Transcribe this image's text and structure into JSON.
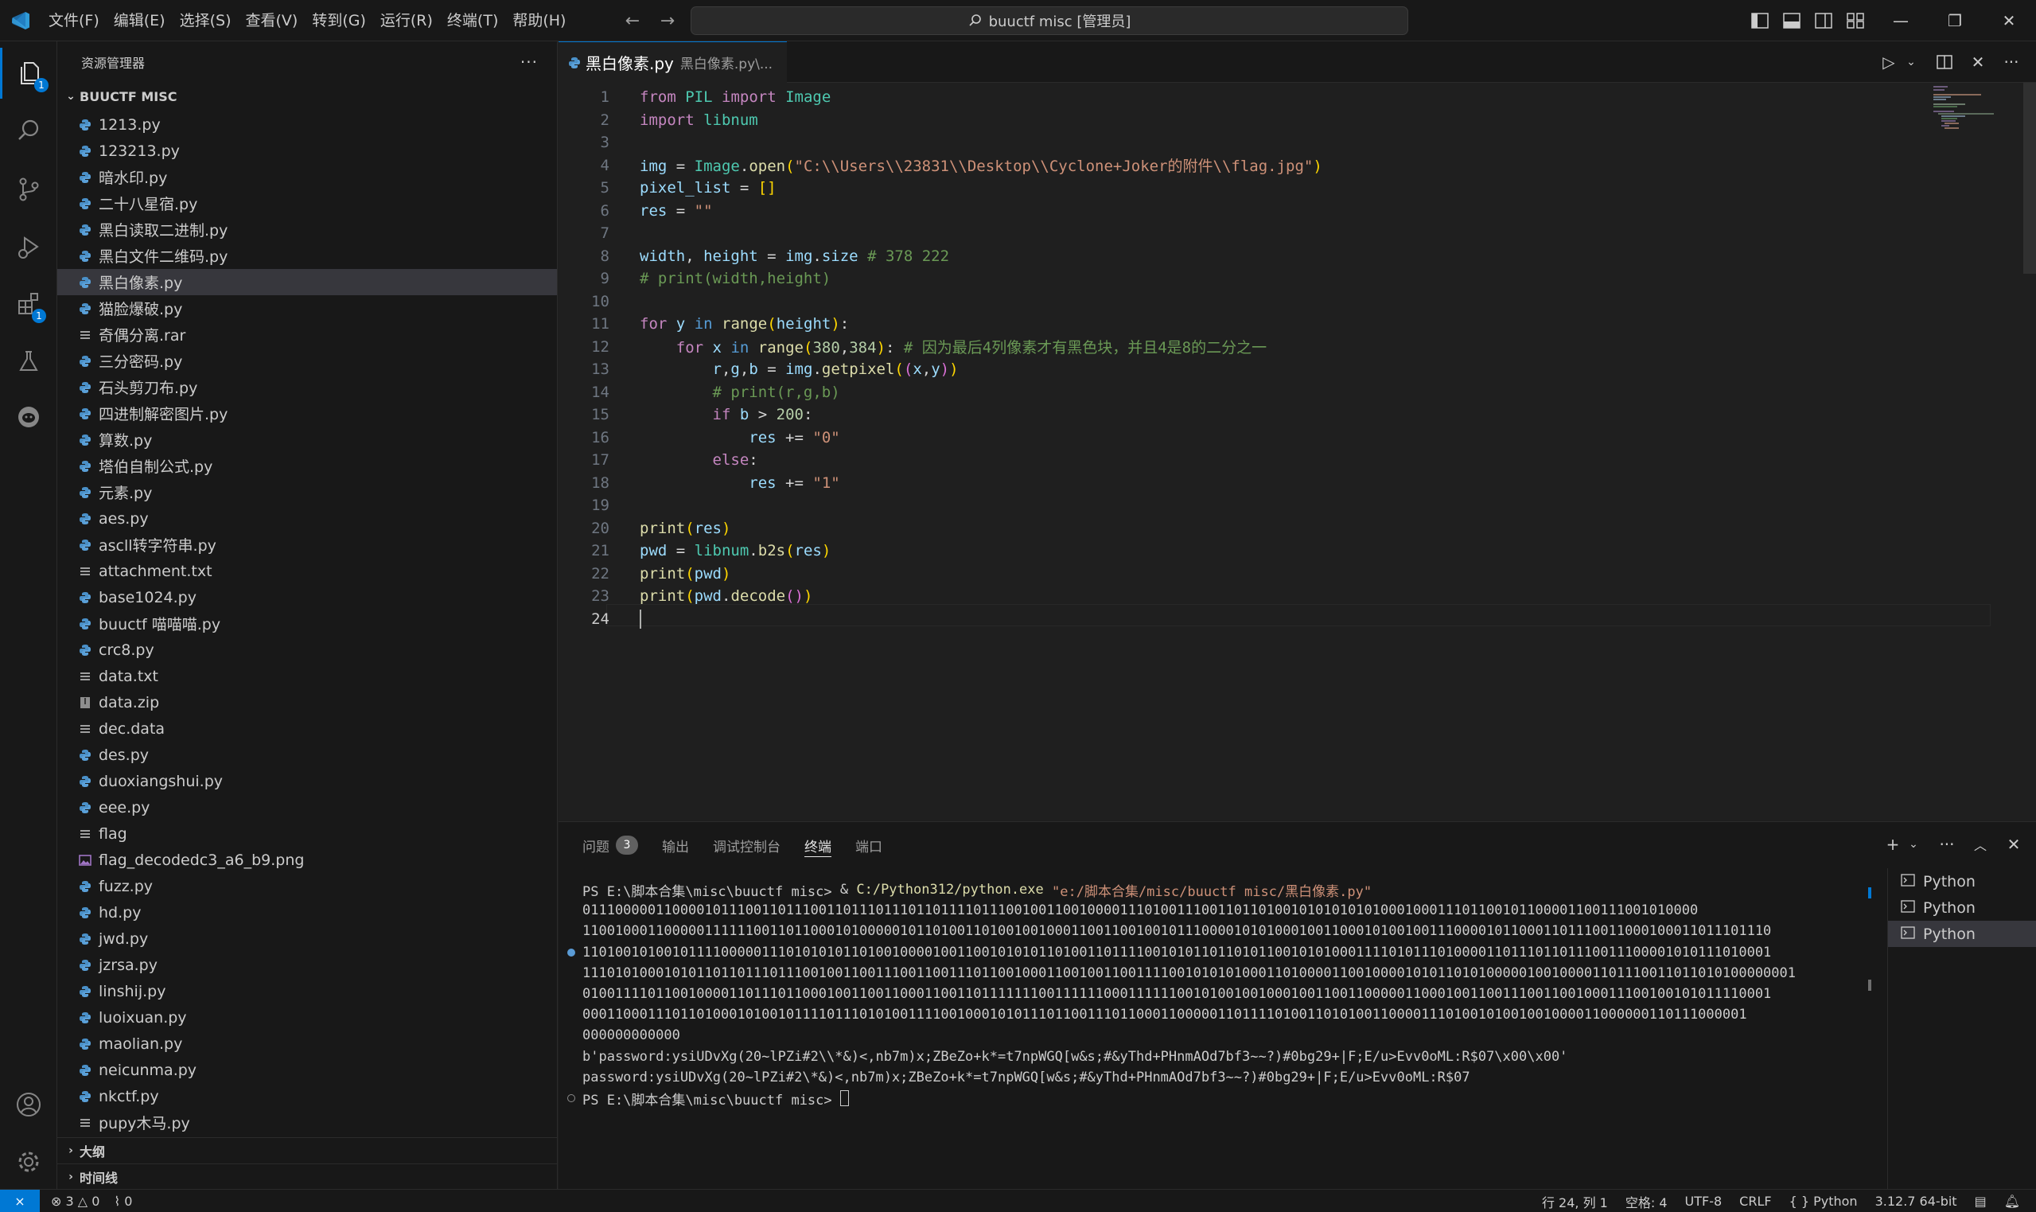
{
  "titlebar": {
    "menu": [
      "文件(F)",
      "编辑(E)",
      "选择(S)",
      "查看(V)",
      "转到(G)",
      "运行(R)",
      "终端(T)",
      "帮助(H)"
    ],
    "search_text": "buuctf misc [管理员]"
  },
  "activitybar": {
    "explorer_badge": "1",
    "extensions_badge": "1"
  },
  "sidebar": {
    "title": "资源管理器",
    "more": "···",
    "folder": "BUUCTF MISC",
    "files": [
      {
        "name": "1213.py",
        "type": "python"
      },
      {
        "name": "123213.py",
        "type": "python"
      },
      {
        "name": "暗水印.py",
        "type": "python"
      },
      {
        "name": "二十八星宿.py",
        "type": "python"
      },
      {
        "name": "黑白读取二进制.py",
        "type": "python"
      },
      {
        "name": "黑白文件二维码.py",
        "type": "python"
      },
      {
        "name": "黑白像素.py",
        "type": "python",
        "selected": true
      },
      {
        "name": "猫脸爆破.py",
        "type": "python"
      },
      {
        "name": "奇偶分离.rar",
        "type": "text"
      },
      {
        "name": "三分密码.py",
        "type": "python"
      },
      {
        "name": "石头剪刀布.py",
        "type": "python"
      },
      {
        "name": "四进制解密图片.py",
        "type": "python"
      },
      {
        "name": "算数.py",
        "type": "python"
      },
      {
        "name": "塔伯自制公式.py",
        "type": "python"
      },
      {
        "name": "元素.py",
        "type": "python"
      },
      {
        "name": "aes.py",
        "type": "python"
      },
      {
        "name": "ascll转字符串.py",
        "type": "python"
      },
      {
        "name": "attachment.txt",
        "type": "text"
      },
      {
        "name": "base1024.py",
        "type": "python"
      },
      {
        "name": "buuctf 喵喵喵.py",
        "type": "python"
      },
      {
        "name": "crc8.py",
        "type": "python"
      },
      {
        "name": "data.txt",
        "type": "text"
      },
      {
        "name": "data.zip",
        "type": "zip"
      },
      {
        "name": "dec.data",
        "type": "text"
      },
      {
        "name": "des.py",
        "type": "python"
      },
      {
        "name": "duoxiangshui.py",
        "type": "python"
      },
      {
        "name": "eee.py",
        "type": "python"
      },
      {
        "name": "flag",
        "type": "text"
      },
      {
        "name": "flag_decodedc3_a6_b9.png",
        "type": "image"
      },
      {
        "name": "fuzz.py",
        "type": "python"
      },
      {
        "name": "hd.py",
        "type": "python"
      },
      {
        "name": "jwd.py",
        "type": "python"
      },
      {
        "name": "jzrsa.py",
        "type": "python"
      },
      {
        "name": "linshij.py",
        "type": "python"
      },
      {
        "name": "luoixuan.py",
        "type": "python"
      },
      {
        "name": "maolian.py",
        "type": "python"
      },
      {
        "name": "neicunma.py",
        "type": "python"
      },
      {
        "name": "nkctf.py",
        "type": "python"
      },
      {
        "name": "pupy木马.py",
        "type": "text"
      }
    ],
    "outline": "大纲",
    "timeline": "时间线"
  },
  "editor": {
    "tab_name": "黑白像素.py",
    "tab_desc": "黑白像素.py\\...",
    "line_numbers": [
      "1",
      "2",
      "3",
      "4",
      "5",
      "6",
      "7",
      "8",
      "9",
      "10",
      "11",
      "12",
      "13",
      "14",
      "15",
      "16",
      "17",
      "18",
      "19",
      "20",
      "21",
      "22",
      "23",
      "24"
    ],
    "lines": [
      [
        [
          "kw",
          "from"
        ],
        [
          "p",
          " "
        ],
        [
          "cls",
          "PIL"
        ],
        [
          "p",
          " "
        ],
        [
          "kw",
          "import"
        ],
        [
          "p",
          " "
        ],
        [
          "cls",
          "Image"
        ]
      ],
      [
        [
          "kw",
          "import"
        ],
        [
          "p",
          " "
        ],
        [
          "cls",
          "libnum"
        ]
      ],
      [],
      [
        [
          "var",
          "img"
        ],
        [
          "p",
          " = "
        ],
        [
          "cls",
          "Image"
        ],
        [
          "p",
          "."
        ],
        [
          "fn",
          "open"
        ],
        [
          "br1",
          "("
        ],
        [
          "str",
          "\"C:\\\\Users\\\\23831\\\\Desktop\\\\Cyclone+Joker的附件\\\\flag.jpg\""
        ],
        [
          "br1",
          ")"
        ]
      ],
      [
        [
          "var",
          "pixel_list"
        ],
        [
          "p",
          " = "
        ],
        [
          "br1",
          "[]"
        ]
      ],
      [
        [
          "var",
          "res"
        ],
        [
          "p",
          " = "
        ],
        [
          "str",
          "\"\""
        ]
      ],
      [],
      [
        [
          "var",
          "width"
        ],
        [
          "p",
          ", "
        ],
        [
          "var",
          "height"
        ],
        [
          "p",
          " = "
        ],
        [
          "var",
          "img"
        ],
        [
          "p",
          "."
        ],
        [
          "var",
          "size"
        ],
        [
          "p",
          " "
        ],
        [
          "cm",
          "# 378 222"
        ]
      ],
      [
        [
          "cm",
          "# print(width,height)"
        ]
      ],
      [],
      [
        [
          "kw",
          "for"
        ],
        [
          "p",
          " "
        ],
        [
          "var",
          "y"
        ],
        [
          "p",
          " "
        ],
        [
          "kw2",
          "in"
        ],
        [
          "p",
          " "
        ],
        [
          "fn",
          "range"
        ],
        [
          "br1",
          "("
        ],
        [
          "var",
          "height"
        ],
        [
          "br1",
          ")"
        ],
        [
          "p",
          ":"
        ]
      ],
      [
        [
          "p",
          "    "
        ],
        [
          "kw",
          "for"
        ],
        [
          "p",
          " "
        ],
        [
          "var",
          "x"
        ],
        [
          "p",
          " "
        ],
        [
          "kw2",
          "in"
        ],
        [
          "p",
          " "
        ],
        [
          "fn",
          "range"
        ],
        [
          "br1",
          "("
        ],
        [
          "num",
          "380"
        ],
        [
          "p",
          ","
        ],
        [
          "num",
          "384"
        ],
        [
          "br1",
          ")"
        ],
        [
          "p",
          ": "
        ],
        [
          "cm",
          "# 因为最后4列像素才有黑色块，并且4是8的二分之一"
        ]
      ],
      [
        [
          "p",
          "        "
        ],
        [
          "var",
          "r"
        ],
        [
          "p",
          ","
        ],
        [
          "var",
          "g"
        ],
        [
          "p",
          ","
        ],
        [
          "var",
          "b"
        ],
        [
          "p",
          " = "
        ],
        [
          "var",
          "img"
        ],
        [
          "p",
          "."
        ],
        [
          "fn",
          "getpixel"
        ],
        [
          "br1",
          "("
        ],
        [
          "br2",
          "("
        ],
        [
          "var",
          "x"
        ],
        [
          "p",
          ","
        ],
        [
          "var",
          "y"
        ],
        [
          "br2",
          ")"
        ],
        [
          "br1",
          ")"
        ]
      ],
      [
        [
          "p",
          "        "
        ],
        [
          "cm",
          "# print(r,g,b)"
        ]
      ],
      [
        [
          "p",
          "        "
        ],
        [
          "kw",
          "if"
        ],
        [
          "p",
          " "
        ],
        [
          "var",
          "b"
        ],
        [
          "p",
          " > "
        ],
        [
          "num",
          "200"
        ],
        [
          "p",
          ":"
        ]
      ],
      [
        [
          "p",
          "            "
        ],
        [
          "var",
          "res"
        ],
        [
          "p",
          " += "
        ],
        [
          "str",
          "\"0\""
        ]
      ],
      [
        [
          "p",
          "        "
        ],
        [
          "kw",
          "else"
        ],
        [
          "p",
          ":"
        ]
      ],
      [
        [
          "p",
          "            "
        ],
        [
          "var",
          "res"
        ],
        [
          "p",
          " += "
        ],
        [
          "str",
          "\"1\""
        ]
      ],
      [],
      [
        [
          "fn",
          "print"
        ],
        [
          "br1",
          "("
        ],
        [
          "var",
          "res"
        ],
        [
          "br1",
          ")"
        ]
      ],
      [
        [
          "var",
          "pwd"
        ],
        [
          "p",
          " = "
        ],
        [
          "cls",
          "libnum"
        ],
        [
          "p",
          "."
        ],
        [
          "fn",
          "b2s"
        ],
        [
          "br1",
          "("
        ],
        [
          "var",
          "res"
        ],
        [
          "br1",
          ")"
        ]
      ],
      [
        [
          "fn",
          "print"
        ],
        [
          "br1",
          "("
        ],
        [
          "var",
          "pwd"
        ],
        [
          "br1",
          ")"
        ]
      ],
      [
        [
          "fn",
          "print"
        ],
        [
          "br1",
          "("
        ],
        [
          "var",
          "pwd"
        ],
        [
          "p",
          "."
        ],
        [
          "fn",
          "decode"
        ],
        [
          "br2",
          "()"
        ],
        [
          "br1",
          ")"
        ]
      ],
      []
    ]
  },
  "panel": {
    "tabs": [
      "问题",
      "输出",
      "调试控制台",
      "终端",
      "端口"
    ],
    "problems_count": "3",
    "active_tab": "终端",
    "terminal": {
      "prompt1": "PS E:\\脚本合集\\misc\\buuctf misc> ",
      "cmd_amp": "& ",
      "cmd_exe": "C:/Python312/python.exe",
      "cmd_arg": " \"e:/脚本合集/misc/buuctf misc/黑白像素.py\"",
      "output": [
        "01110000011000010111001101110011011101110110111101110010011001000011101001110011011010010101010101000100011101100101100001100111001010000",
        "11001000110000011111100110110001010000010110100110100100100011001100100101110000101010001001100010100100111000010110001101110011000100011011101110",
        "11010010100101111000001110101010110100100001001100101010110100110111100101011011010110010101000111101011101000011011101101110011100001010111010001",
        "11101010001010110110111011100100110011100110011101100100011001001100111100101010100011010000110010000101011010100000100100001101110011011010100000001",
        "01001111011001000011011101100010011001100011001101111111001111110001111110010100100100010011001100000110001001100111001100100011100100101011110001",
        "00011000111011010001010010111101110101001111001000101011101100111011000110000011011110100110101001100001110100101001001000011000000110111000001",
        "000000000000",
        "b'password:ysiUDvXg(20~lPZi#2\\\\*&)<,nb7m)x;ZBeZo+k*=t7npWGQ[w&s;#&yThd+PHnmAOd7bf3~~?)#0bg29+|F;E/u>Evv0oML:R$07\\x00\\x00'",
        "password:ysiUDvXg(20~lPZi#2\\*&)<,nb7m)x;ZBeZo+k*=t7npWGQ[w&s;#&yThd+PHnmAOd7bf3~~?)#0bg29+|F;E/u>Evv0oML:R$07"
      ],
      "prompt2": "PS E:\\脚本合集\\misc\\buuctf misc> "
    },
    "terminal_list": [
      "Python",
      "Python",
      "Python"
    ]
  },
  "statusbar": {
    "errors": "3",
    "warnings": "0",
    "ports": "0",
    "position": "行 24, 列 1",
    "spaces": "空格: 4",
    "encoding": "UTF-8",
    "eol": "CRLF",
    "language": "Python",
    "interpreter": "3.12.7 64-bit"
  },
  "colors": {
    "accent": "#0078d4",
    "keyword": "#c586c0",
    "string": "#ce9178",
    "comment": "#6a9955"
  }
}
